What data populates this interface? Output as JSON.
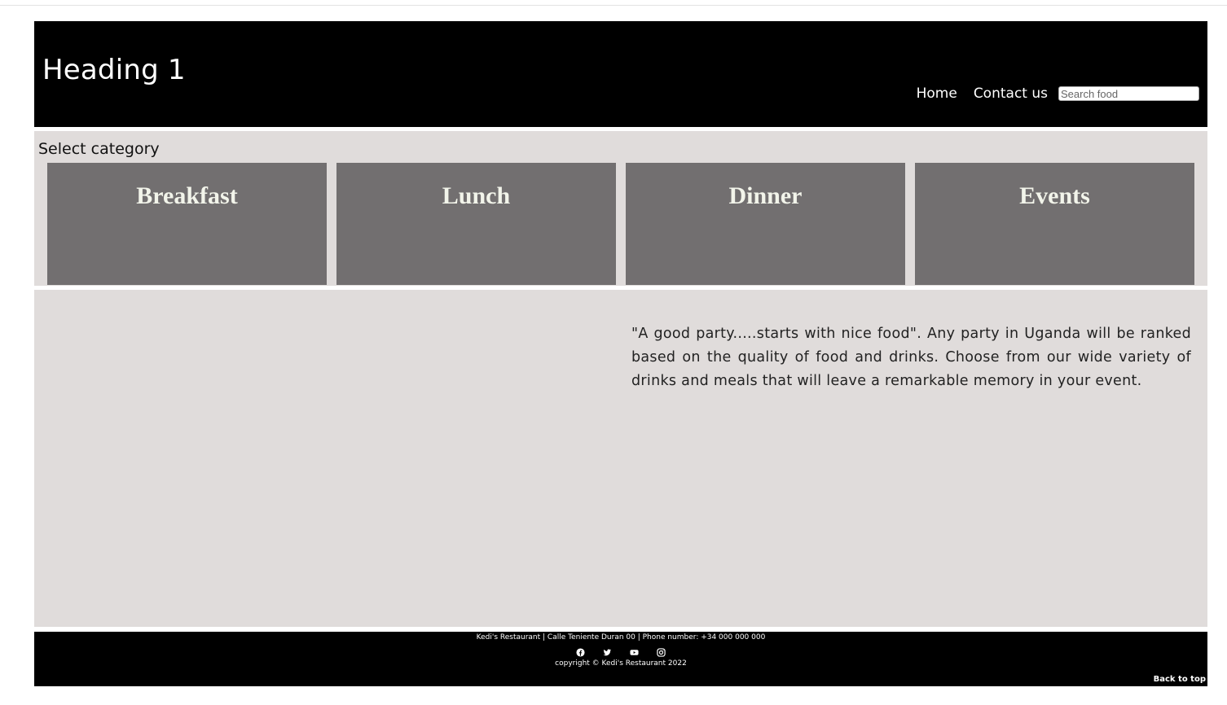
{
  "header": {
    "title": "Heading 1",
    "nav": [
      "Home",
      "Contact us"
    ],
    "search_placeholder": "Search food"
  },
  "categories": {
    "label": "Select category",
    "items": [
      "Breakfast",
      "Lunch",
      "Dinner",
      "Events"
    ]
  },
  "content": {
    "quote": "\"A good party.....starts with nice food\". Any party in Uganda will be ranked based on the quality of food and drinks. Choose from our wide variety of drinks and meals that will leave a remarkable memory in your event."
  },
  "footer": {
    "address": "Kedi's Restaurant | Calle Teniente Duran 00 | Phone number: +34 000 000 000",
    "socials": [
      "facebook-icon",
      "twitter-icon",
      "youtube-icon",
      "instagram-icon"
    ],
    "copyright": "copyright © Kedi's Restaurant 2022",
    "back_to_top": "Back to top"
  },
  "colors": {
    "header_bg": "#000000",
    "panel_bg": "#e0dcdb",
    "card_bg": "#726f70",
    "card_text": "#f2f4ea"
  }
}
